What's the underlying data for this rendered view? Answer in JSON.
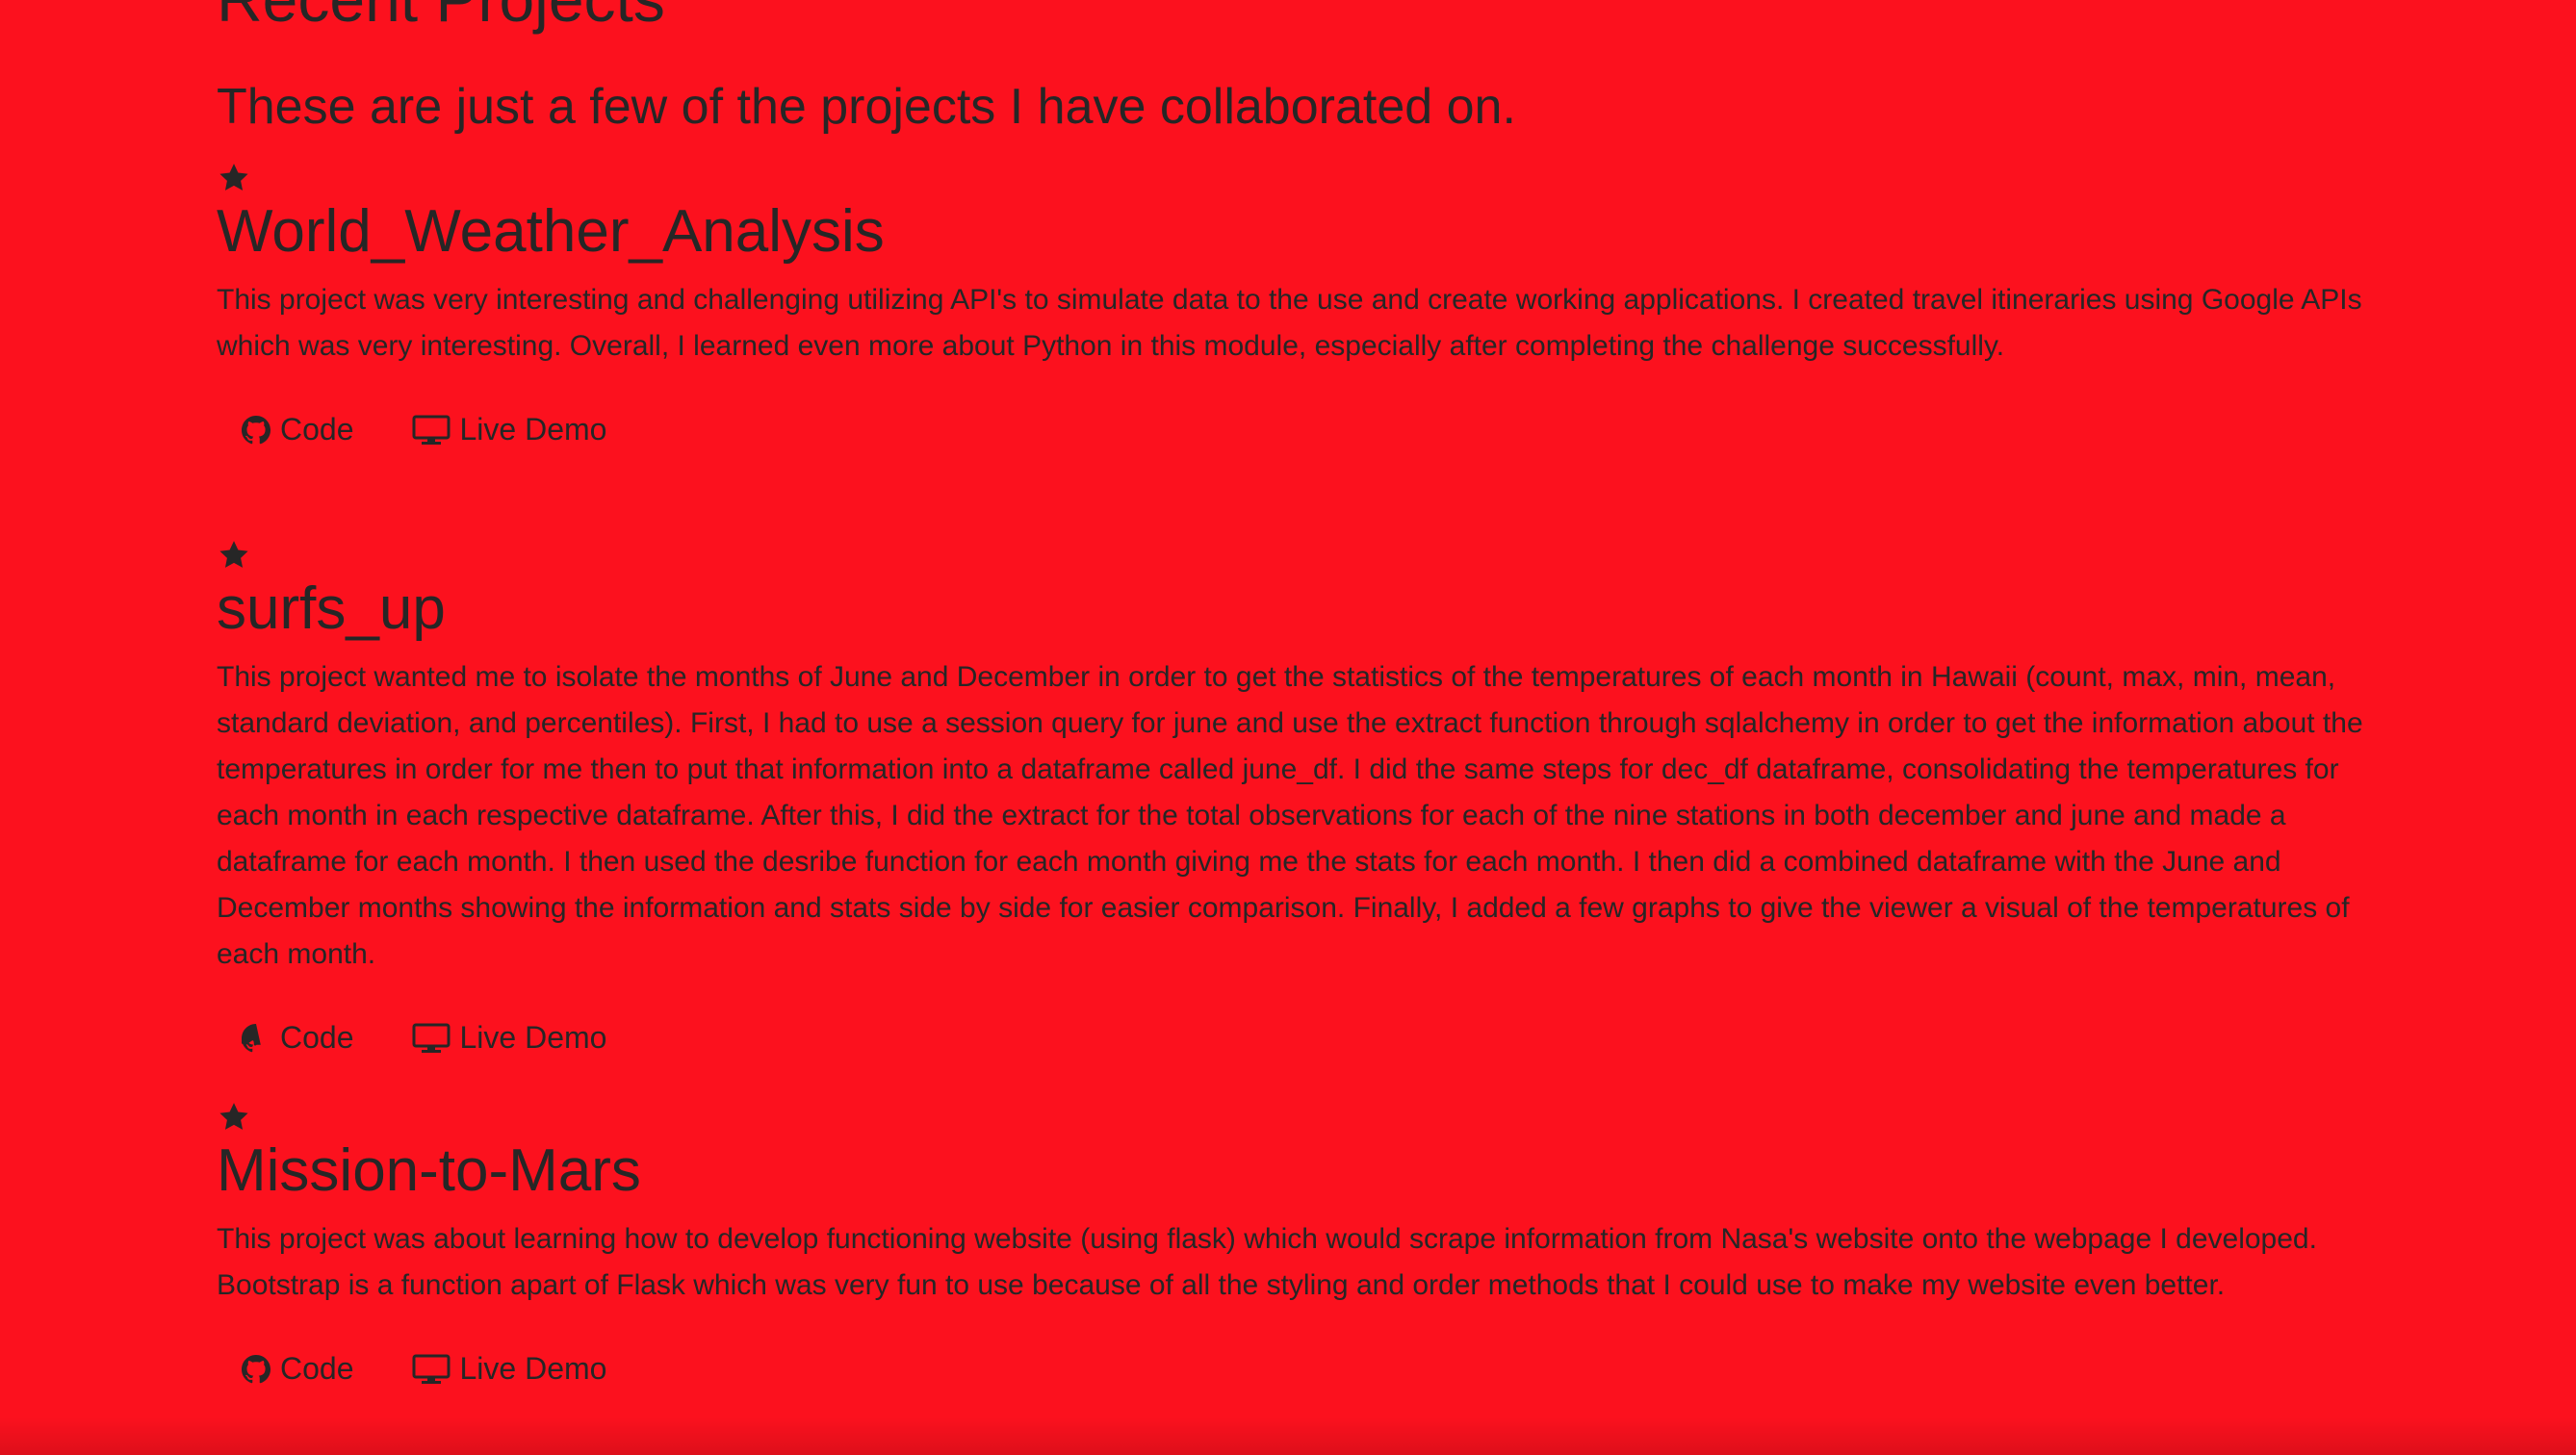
{
  "section": {
    "title": "Recent Projects",
    "subtitle": "These are just a few of the projects I have collaborated on."
  },
  "theme": {
    "background": "#fc111e",
    "text": "#262626"
  },
  "projects": [
    {
      "icon": "star-icon",
      "title": "World_Weather_Analysis",
      "description": "This project was very interesting and challenging utilizing API's to simulate data to the use and create working applications. I created travel itineraries using Google APIs which was very interesting. Overall, I learned even more about Python in this module, especially after completing the challenge successfully.",
      "code_label": "Code",
      "code_icon": "github-icon",
      "demo_label": "Live Demo",
      "demo_icon": "desktop-icon"
    },
    {
      "icon": "star-icon",
      "title": "surfs_up",
      "description": "This project wanted me to isolate the months of June and December in order to get the statistics of the temperatures of each month in Hawaii (count, max, min, mean, standard deviation, and percentiles). First, I had to use a session query for june and use the extract function through sqlalchemy in order to get the information about the temperatures in order for me then to put that information into a dataframe called june_df. I did the same steps for dec_df dataframe, consolidating the temperatures for each month in each respective dataframe. After this, I did the extract for the total observations for each of the nine stations in both december and june and made a dataframe for each month. I then used the desribe function for each month giving me the stats for each month. I then did a combined dataframe with the June and December months showing the information and stats side by side for easier comparison. Finally, I added a few graphs to give the viewer a visual of the temperatures of each month.",
      "code_label": "Code",
      "code_icon": "github-icon",
      "demo_label": "Live Demo",
      "demo_icon": "desktop-icon"
    },
    {
      "icon": "star-icon",
      "title": "Mission-to-Mars",
      "description": "This project was about learning how to develop functioning website (using flask) which would scrape information from Nasa's website onto the webpage I developed. Bootstrap is a function apart of Flask which was very fun to use because of all the styling and order methods that I could use to make my website even better.",
      "code_label": "Code",
      "code_icon": "github-icon",
      "demo_label": "Live Demo",
      "demo_icon": "desktop-icon"
    }
  ]
}
